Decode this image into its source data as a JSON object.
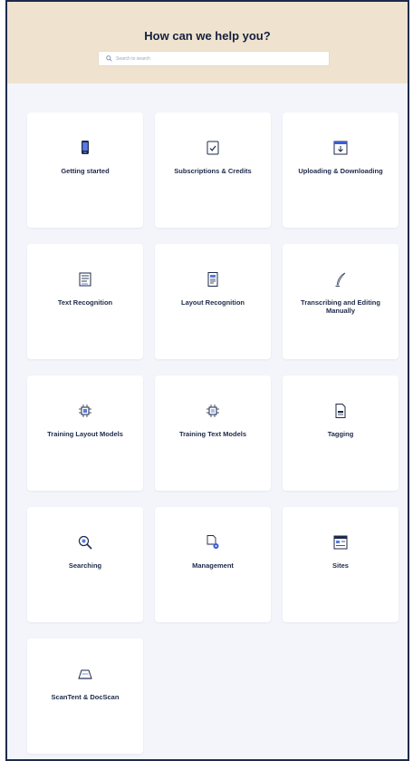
{
  "help": {
    "title": "How can we help you?",
    "search_placeholder": "Search to search"
  },
  "categories": [
    {
      "label": "Getting started",
      "icon": "phone-icon"
    },
    {
      "label": "Subscriptions & Credits",
      "icon": "credit-card-icon"
    },
    {
      "label": "Uploading & Downloading",
      "icon": "upload-download-icon"
    },
    {
      "label": "Text Recognition",
      "icon": "text-recognition-icon"
    },
    {
      "label": "Layout Recognition",
      "icon": "layout-recognition-icon"
    },
    {
      "label": "Transcribing and Editing Manually",
      "icon": "quill-icon"
    },
    {
      "label": "Training Layout Models",
      "icon": "layout-model-chip-icon"
    },
    {
      "label": "Training Text Models",
      "icon": "text-model-chip-icon"
    },
    {
      "label": "Tagging",
      "icon": "tag-document-icon"
    },
    {
      "label": "Searching",
      "icon": "magnifier-icon"
    },
    {
      "label": "Management",
      "icon": "document-gear-icon"
    },
    {
      "label": "Sites",
      "icon": "sites-window-icon"
    },
    {
      "label": "ScanTent & DocScan",
      "icon": "scan-tent-icon"
    }
  ],
  "colors": {
    "hero_bg": "#efe3cf",
    "page_bg": "#f3f5fa",
    "navy": "#1e2a4a",
    "accent_blue": "#3a5bd9"
  }
}
